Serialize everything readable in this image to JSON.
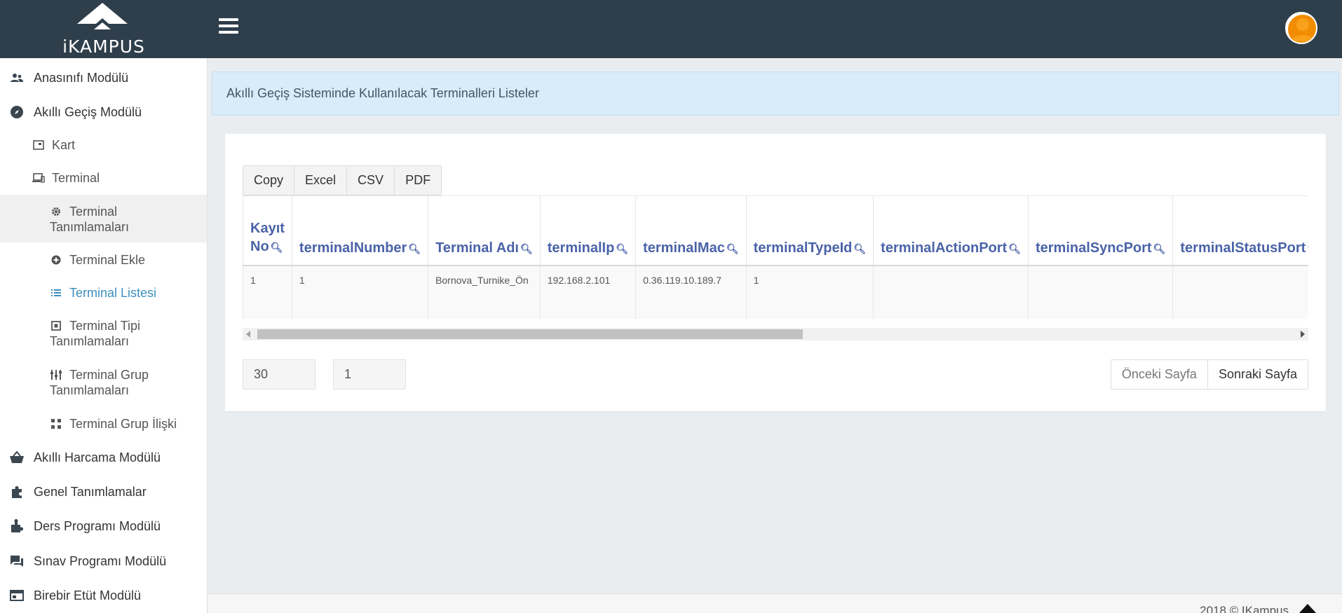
{
  "brand": {
    "name": "iKAMPUS"
  },
  "sidebar": {
    "items": [
      {
        "label": "Anasınıfı Modülü",
        "icon": "users-icon"
      },
      {
        "label": "Akıllı Geçiş Modülü",
        "icon": "compass-icon"
      },
      {
        "label": "Kart",
        "icon": "card-icon"
      },
      {
        "label": "Terminal",
        "icon": "devices-icon"
      },
      {
        "label": "Terminal Tanımlamaları",
        "icon": "gear-icon"
      },
      {
        "label": "Terminal Ekle",
        "icon": "plus-circle-icon"
      },
      {
        "label": "Terminal Listesi",
        "icon": "list-icon"
      },
      {
        "label": "Terminal Tipi Tanımlamaları",
        "icon": "square-icon"
      },
      {
        "label": "Terminal Grup Tanımlamaları",
        "icon": "sliders-icon"
      },
      {
        "label": "Terminal Grup İlişki",
        "icon": "group-icon"
      },
      {
        "label": "Akıllı Harcama Modülü",
        "icon": "basket-icon"
      },
      {
        "label": "Genel Tanımlamalar",
        "icon": "puzzle-icon"
      },
      {
        "label": "Ders Programı Modülü",
        "icon": "puzzle-piece-icon"
      },
      {
        "label": "Sınav Programı Modülü",
        "icon": "chat-icon"
      },
      {
        "label": "Birebir Etüt Modülü",
        "icon": "window-icon"
      }
    ]
  },
  "info": {
    "text": "Akıllı Geçiş Sisteminde Kullanılacak Terminalleri Listeler"
  },
  "toolbar": {
    "copy": "Copy",
    "excel": "Excel",
    "csv": "CSV",
    "pdf": "PDF"
  },
  "table": {
    "headers": [
      "Kayıt No",
      "terminalNumber",
      "Terminal Adı",
      "terminalIp",
      "terminalMac",
      "terminalTypeId",
      "terminalActionPort",
      "terminalSyncPort",
      "terminalStatusPort"
    ],
    "rows": [
      [
        "1",
        "1",
        "Bornova_Turnike_Ön",
        "192.168.2.101",
        "0.36.119.10.189.7",
        "1",
        "",
        "",
        ""
      ]
    ]
  },
  "paging": {
    "page_size": "30",
    "page_number": "1",
    "prev": "Önceki Sayfa",
    "next": "Sonraki Sayfa"
  },
  "footer": {
    "text": "2018 © IKampus"
  },
  "colors": {
    "topbar": "#2f3e4b",
    "accent": "#3d8ebd",
    "header_text": "#4a63a8",
    "info_bg": "#d9ecf9",
    "avatar": "#f28c00"
  }
}
